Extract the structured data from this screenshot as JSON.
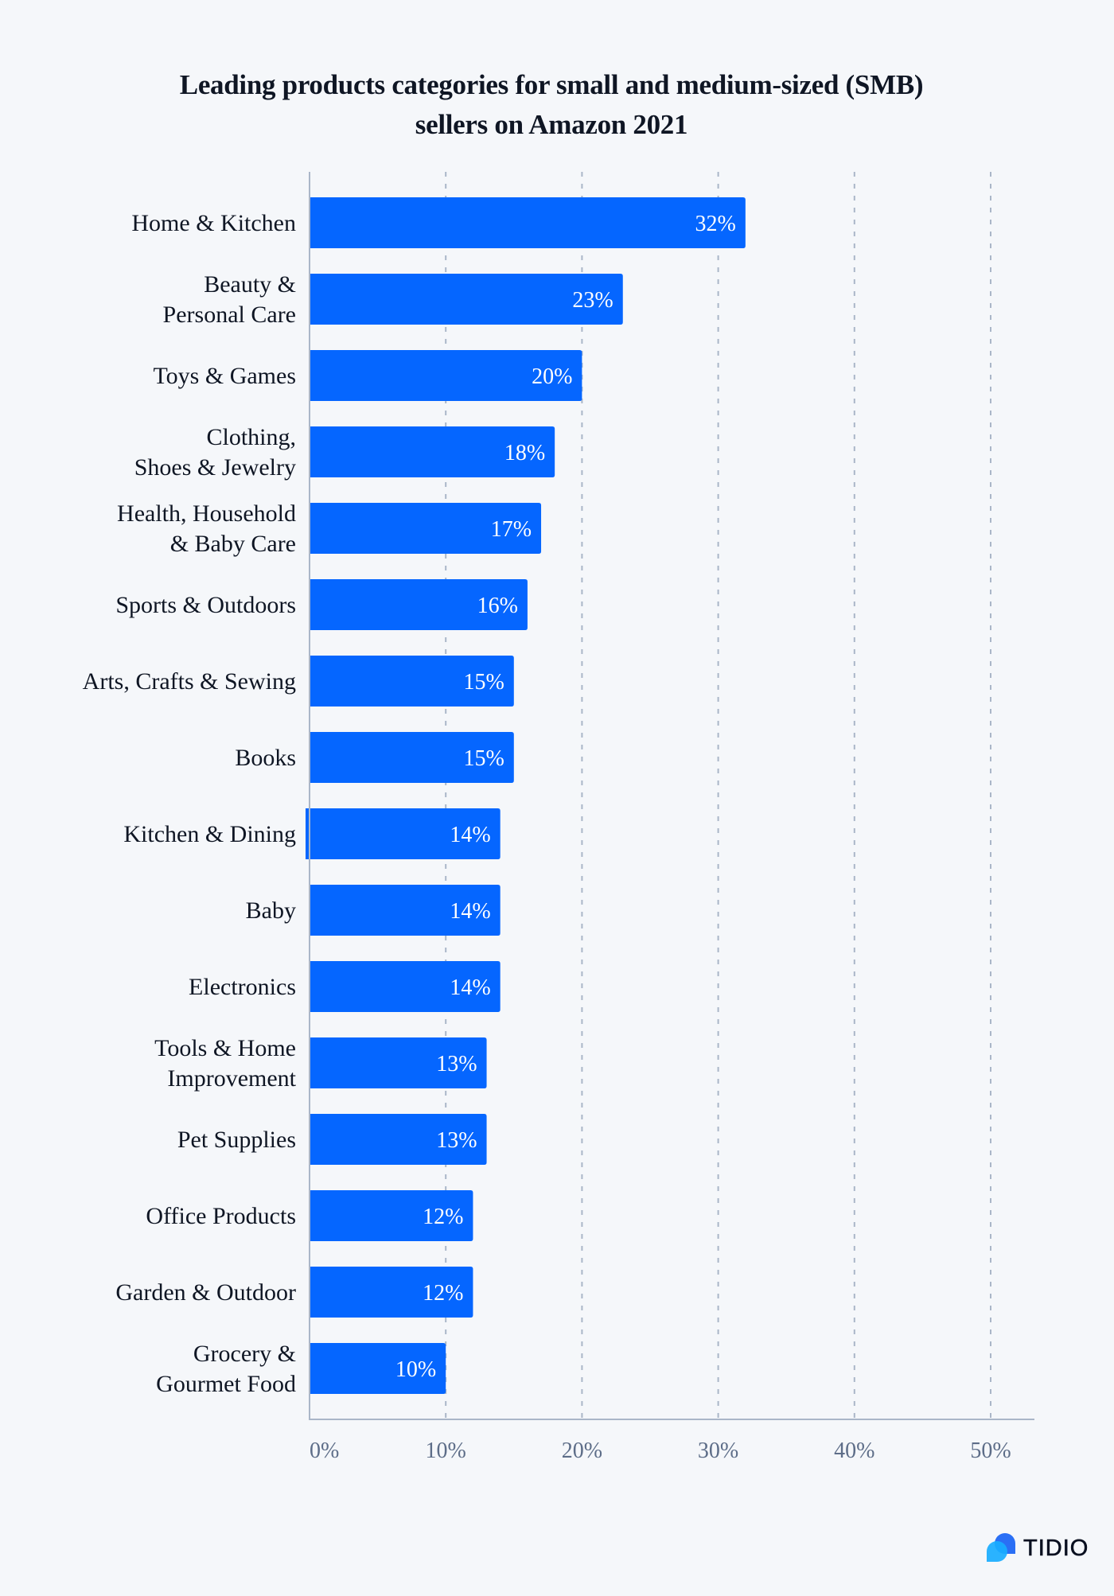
{
  "chart_data": {
    "type": "bar",
    "orientation": "horizontal",
    "title": "Leading products categories for small and medium-sized (SMB) sellers on Amazon 2021",
    "title_lines": [
      "Leading products categories for small and medium-sized (SMB)",
      "sellers on Amazon 2021"
    ],
    "categories": [
      "Home & Kitchen",
      "Beauty & Personal Care",
      "Toys & Games",
      "Clothing, Shoes & Jewelry",
      "Health, Household & Baby Care",
      "Sports & Outdoors",
      "Arts, Crafts & Sewing",
      "Books",
      "Kitchen & Dining",
      "Baby",
      "Electronics",
      "Tools & Home Improvement",
      "Pet Supplies",
      "Office Products",
      "Garden & Outdoor",
      "Grocery & Gourmet Food"
    ],
    "category_label_lines": [
      [
        "Home & Kitchen"
      ],
      [
        "Beauty &",
        "Personal Care"
      ],
      [
        "Toys & Games"
      ],
      [
        "Clothing,",
        "Shoes & Jewelry"
      ],
      [
        "Health, Household",
        "& Baby Care"
      ],
      [
        "Sports & Outdoors"
      ],
      [
        "Arts, Crafts & Sewing"
      ],
      [
        "Books"
      ],
      [
        "Kitchen & Dining"
      ],
      [
        "Baby"
      ],
      [
        "Electronics"
      ],
      [
        "Tools & Home",
        "Improvement"
      ],
      [
        "Pet Supplies"
      ],
      [
        "Office Products"
      ],
      [
        "Garden & Outdoor"
      ],
      [
        "Grocery &",
        "Gourmet Food"
      ]
    ],
    "values": [
      32,
      23,
      20,
      18,
      17,
      16,
      15,
      15,
      14,
      14,
      14,
      13,
      13,
      12,
      12,
      10
    ],
    "value_labels": [
      "32%",
      "23%",
      "20%",
      "18%",
      "17%",
      "16%",
      "15%",
      "15%",
      "14%",
      "14%",
      "14%",
      "13%",
      "13%",
      "12%",
      "12%",
      "10%"
    ],
    "xlabel": "",
    "ylabel": "",
    "xlim": [
      0,
      53
    ],
    "xticks": [
      0,
      10,
      20,
      30,
      40,
      50
    ],
    "xtick_labels": [
      "0%",
      "10%",
      "20%",
      "30%",
      "40%",
      "50%"
    ],
    "grid": "vertical dashed",
    "legend": "none",
    "unit": "%",
    "bar_color": "#0566ff"
  },
  "colors": {
    "background": "#f5f7fa",
    "bar": "#0566ff",
    "text": "#0f1624",
    "axis": "#aab6c8",
    "tick_text": "#5d6d88",
    "logo_back": "#2a6ff5",
    "logo_front": "#18acff"
  },
  "branding": {
    "logo_text": "TIDIO",
    "logo_icon": "tidio-chat-bubbles-icon"
  }
}
